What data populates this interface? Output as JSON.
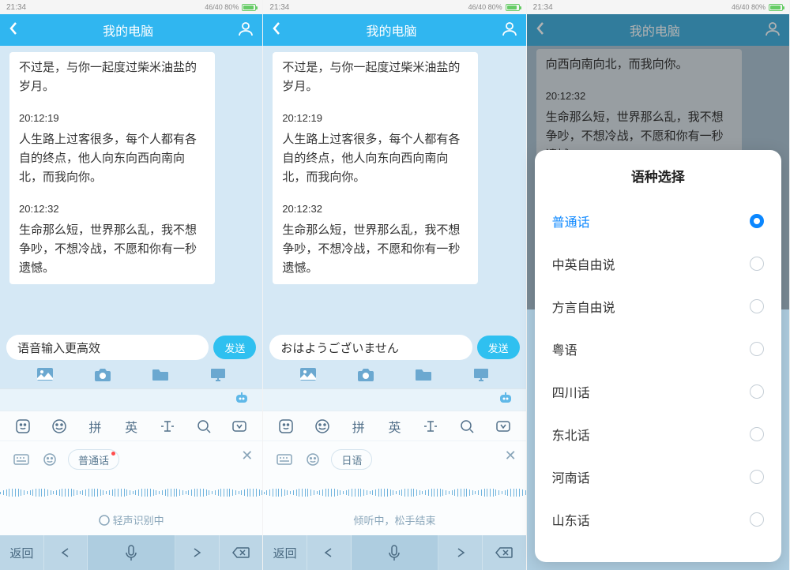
{
  "status": {
    "time": "21:34",
    "signal": "46/40 80%"
  },
  "header": {
    "title": "我的电脑"
  },
  "chat": {
    "intro": "不过是，与你一起度过柴米油盐的岁月。",
    "msgs": [
      {
        "ts": "20:12:19",
        "text": "人生路上过客很多，每个人都有各自的终点，他人向东向西向南向北，而我向你。"
      },
      {
        "ts": "20:12:32",
        "text": "生命那么短，世界那么乱，我不想争吵，不想冷战，不愿和你有一秒遗憾。"
      }
    ]
  },
  "p3chat": {
    "line1": "向西向南向北，而我向你。",
    "ts": "20:12:32",
    "text": "生命那么短，世界那么乱，我不想争吵，不想冷战，不愿和你有一秒遗憾。"
  },
  "input1": {
    "text": "语音输入更高效"
  },
  "input2": {
    "text": "おはようございません"
  },
  "send": "发送",
  "kb": {
    "t1": "拼",
    "t2": "英"
  },
  "voice1": {
    "lang": "普通话",
    "hint": "轻声识别中"
  },
  "voice2": {
    "lang": "日语",
    "hint": "倾听中，松手结束"
  },
  "back": "返回",
  "sheet": {
    "title": "语种选择",
    "options": [
      "普通话",
      "中英自由说",
      "方言自由说",
      "粤语",
      "四川话",
      "东北话",
      "河南话",
      "山东话"
    ],
    "selected": 0
  }
}
